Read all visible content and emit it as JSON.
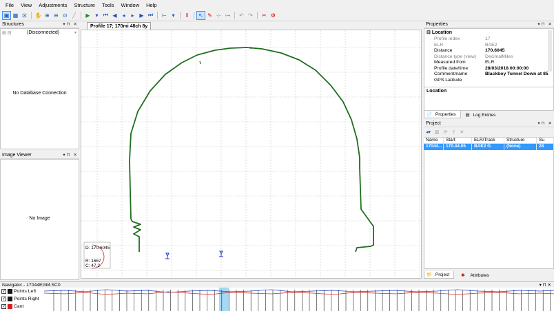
{
  "menu": [
    "File",
    "View",
    "Adjustments",
    "Structure",
    "Tools",
    "Window",
    "Help"
  ],
  "panels": {
    "structures": {
      "title": "Structures",
      "combo_value": "(Disconnected)",
      "empty_text": "No Database Connection"
    },
    "image_viewer": {
      "title": "Image Viewer",
      "empty_text": "No Image"
    },
    "properties": {
      "title": "Properties",
      "section": "Location",
      "rows": [
        {
          "key": "Profile index",
          "value": "17",
          "bold": false,
          "dim": true
        },
        {
          "key": "ELR",
          "value": "BAE2",
          "bold": false,
          "dim": true
        },
        {
          "key": "Distance",
          "value": "170.6045",
          "bold": true,
          "dim": false
        },
        {
          "key": "Distance type (view)",
          "value": "DecimalMiles",
          "bold": false,
          "dim": true
        },
        {
          "key": "Measured from",
          "value": "ELR",
          "bold": false,
          "dim": false
        },
        {
          "key": "Profile date/time",
          "value": "28/03/2018 00:00:00",
          "bold": true,
          "dim": false
        },
        {
          "key": "Comment/name",
          "value": "Blackboy Tunnel Down at 85",
          "bold": true,
          "dim": false
        },
        {
          "key": "GPS Latitude",
          "value": "",
          "bold": false,
          "dim": false
        }
      ],
      "desc_title": "Location",
      "tabs": [
        "Properties",
        "Log Entries"
      ]
    },
    "project": {
      "title": "Project",
      "columns": [
        "Name",
        "Start",
        "ELR/Track",
        "Structure",
        "Su"
      ],
      "row": [
        "17044...",
        "170.44.05",
        "BAE2 G",
        "(None)",
        "28"
      ],
      "tabs": [
        "Project",
        "Attributes"
      ]
    }
  },
  "document": {
    "tab_title": "Profile 17; 170mi 48ch 8y",
    "readout": {
      "d": "D: 170.6045",
      "r": "R: 1667",
      "c": "C: 47.2"
    }
  },
  "navigator": {
    "title": "Navigator - 17044EGM.SC0",
    "legend": [
      {
        "label": "Points Left",
        "color": "#1a1a1a"
      },
      {
        "label": "Points Right",
        "color": "#1a1a1a"
      },
      {
        "label": "Cant",
        "color": "#d42020"
      }
    ]
  }
}
